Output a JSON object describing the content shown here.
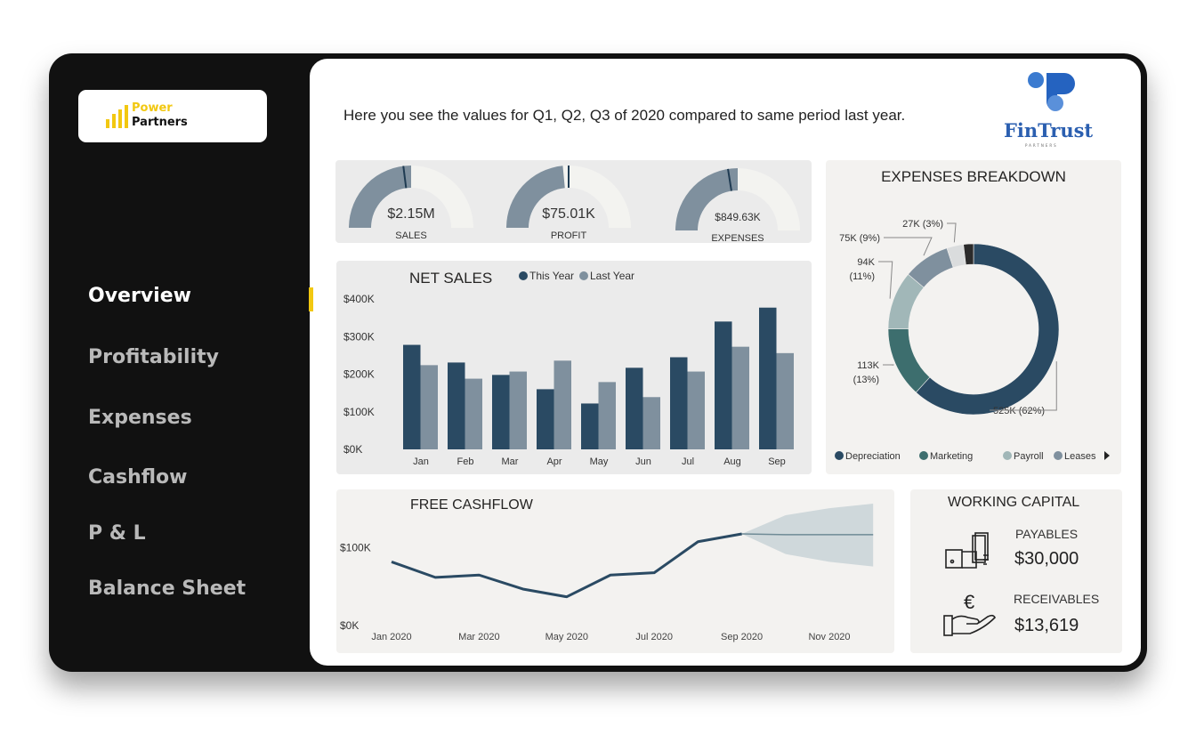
{
  "brand": {
    "logo_line1": "Power",
    "logo_line2": "Partners",
    "client_logo": "FinTrust",
    "client_logo_sub": "PARTNERS",
    "accent": "#f2c811"
  },
  "nav": [
    {
      "label": "Overview",
      "active": true
    },
    {
      "label": "Profitability"
    },
    {
      "label": "Expenses"
    },
    {
      "label": "Cashflow"
    },
    {
      "label": "P & L"
    },
    {
      "label": "Balance Sheet"
    }
  ],
  "header": {
    "text": "Here you see the values for Q1, Q2, Q3 of 2020 compared to same period last year."
  },
  "kpis": [
    {
      "value": "$2.15M",
      "label": "SALES",
      "fill": 0.5,
      "target": 0.46
    },
    {
      "value": "$75.01K",
      "label": "PROFIT",
      "fill": 0.47,
      "target": 0.5
    },
    {
      "value": "$849.63K",
      "label": "EXPENSES",
      "fill": 0.5,
      "target": 0.45
    }
  ],
  "working_capital": {
    "title": "WORKING CAPITAL",
    "payables_label": "PAYABLES",
    "payables_value": "$30,000",
    "receivables_label": "RECEIVABLES",
    "receivables_value": "$13,619",
    "payables_icon": "hand-cash-icon",
    "receivables_icon": "hand-euro-icon"
  },
  "chart_data": [
    {
      "type": "bar",
      "title": "NET SALES",
      "categories": [
        "Jan",
        "Feb",
        "Mar",
        "Apr",
        "May",
        "Jun",
        "Jul",
        "Aug",
        "Sep"
      ],
      "series": [
        {
          "name": "This Year",
          "color": "#2a4a63",
          "values": [
            278,
            231,
            198,
            160,
            122,
            217,
            245,
            340,
            377
          ]
        },
        {
          "name": "Last Year",
          "color": "#7f909e",
          "values": [
            224,
            188,
            207,
            236,
            179,
            139,
            207,
            273,
            256
          ]
        }
      ],
      "yticks": [
        "$0K",
        "$100K",
        "$200K",
        "$300K",
        "$400K"
      ],
      "ylim": [
        0,
        400
      ],
      "unit": "K$",
      "legend": "top"
    },
    {
      "type": "pie",
      "title": "EXPENSES BREAKDOWN",
      "donut": true,
      "slices": [
        {
          "name": "Depreciation",
          "value": 525,
          "label": "525K (62%)",
          "color": "#2a4a63"
        },
        {
          "name": "Marketing",
          "value": 113,
          "label": "113K (13%)",
          "color": "#3d6e6e"
        },
        {
          "name": "Payroll",
          "value": 94,
          "label": "94K (11%)",
          "color": "#a1b7b8"
        },
        {
          "name": "Leases",
          "value": 75,
          "label": "75K (9%)",
          "color": "#7f909e"
        },
        {
          "value": 27,
          "label": "27K (3%)",
          "color": "#dadcdd"
        },
        {
          "value": 16,
          "color": "#2b2b2b"
        }
      ],
      "legend": "bottom"
    },
    {
      "type": "line",
      "title": "FREE CASHFLOW",
      "x": [
        "Jan 2020",
        "Feb 2020",
        "Mar 2020",
        "Apr 2020",
        "May 2020",
        "Jun 2020",
        "Jul 2020",
        "Aug 2020",
        "Sep 2020"
      ],
      "values": [
        82,
        62,
        65,
        47,
        37,
        65,
        68,
        108,
        118
      ],
      "forecast": {
        "x": [
          "Sep 2020",
          "Oct 2020",
          "Nov 2020",
          "Dec 2020"
        ],
        "values": [
          118,
          117,
          117,
          117
        ],
        "upper": [
          118,
          142,
          151,
          157
        ],
        "lower": [
          118,
          92,
          82,
          76
        ]
      },
      "xticks": [
        "Jan 2020",
        "Mar 2020",
        "May 2020",
        "Jul 2020",
        "Sep 2020",
        "Nov 2020"
      ],
      "yticks": [
        "$0K",
        "$100K"
      ],
      "ylim": [
        0,
        180
      ],
      "color": "#2a4a63",
      "band_color": "#cfd8db"
    }
  ]
}
